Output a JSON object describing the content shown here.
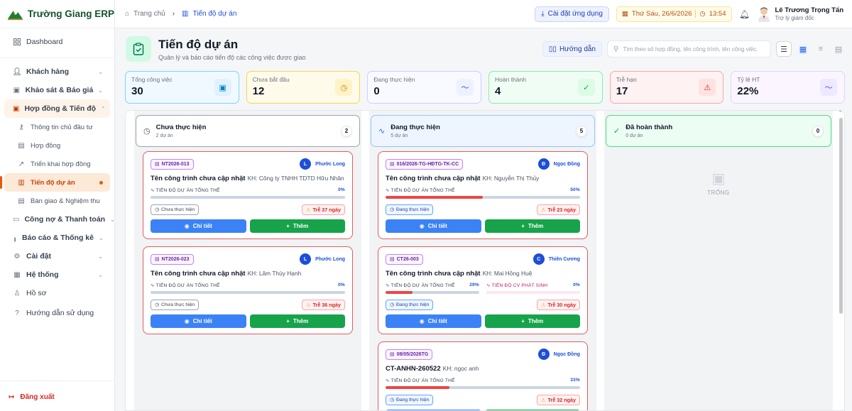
{
  "app": {
    "name": "Trường Giang ERP"
  },
  "sidebar": {
    "items": [
      {
        "label": "Dashboard"
      },
      {
        "label": "Khách hàng"
      },
      {
        "label": "Khảo sát & Báo giá"
      },
      {
        "label": "Hợp đồng & Tiến độ"
      },
      {
        "label": "Thông tin chủ đầu tư"
      },
      {
        "label": "Hợp đồng"
      },
      {
        "label": "Triển khai hợp đồng"
      },
      {
        "label": "Tiến độ dự án"
      },
      {
        "label": "Bàn giao & Nghiệm thu"
      },
      {
        "label": "Công nợ & Thanh toán"
      },
      {
        "label": "Báo cáo & Thống kê"
      },
      {
        "label": "Cài đặt"
      },
      {
        "label": "Hệ thống"
      },
      {
        "label": "Hồ sơ"
      },
      {
        "label": "Hướng dẫn sử dụng"
      }
    ],
    "logout": "Đăng xuất"
  },
  "topbar": {
    "breadcrumb_home": "Trang chủ",
    "breadcrumb_current": "Tiến độ dự án",
    "install_label": "Cài đặt ứng dụng",
    "date": "Thứ Sáu, 26/6/2026",
    "time": "13:54",
    "user_name": "Lê Trương Trọng Tấn",
    "user_role": "Trợ lý giám đốc"
  },
  "page": {
    "title": "Tiến độ dự án",
    "subtitle": "Quản lý và báo cáo tiến độ các công việc được giao",
    "guide_label": "Hướng dẫn",
    "search_placeholder": "Tìm theo số hợp đồng, tên công trình, tên công việc."
  },
  "stats": [
    {
      "label": "Tổng công việc",
      "value": "30",
      "color": "#38bdf8"
    },
    {
      "label": "Chưa bắt đầu",
      "value": "12",
      "color": "#f59e0b"
    },
    {
      "label": "Đang thực hiện",
      "value": "0",
      "color": "#818cf8"
    },
    {
      "label": "Hoàn thành",
      "value": "4",
      "color": "#22c55e"
    },
    {
      "label": "Trễ hạn",
      "value": "17",
      "color": "#f87171"
    },
    {
      "label": "Tỷ lệ HT",
      "value": "22%",
      "color": "#a78bfa"
    }
  ],
  "columns": [
    {
      "title": "Chưa thực hiện",
      "sub": "2 dự án",
      "count": "2"
    },
    {
      "title": "Đang thực hiện",
      "sub": "5 dự án",
      "count": "5"
    },
    {
      "title": "Đã hoàn thành",
      "sub": "0 dự án",
      "count": "0",
      "empty": "TRỐNG"
    }
  ],
  "cards": [
    {
      "code": "NT2026-013",
      "av": "L",
      "assignee": "Phước Long",
      "name": "Tên công trình chưa cập nhật",
      "kh": "KH: Công ty TNHH TDTD Hữu Nhân",
      "p1_label": "TIẾN ĐỘ DỰ ÁN TỔNG THỂ",
      "p1": "0%",
      "p1_val": 0,
      "status": "Chưa thực hiện",
      "late": "Trễ 37 ngày",
      "detail": "Chi tiết",
      "add": "Thêm"
    },
    {
      "code": "NT2026-023",
      "av": "L",
      "assignee": "Phước Long",
      "name": "Tên công trình chưa cập nhật",
      "kh": "KH: Lâm Thúy Hạnh",
      "p1_label": "TIẾN ĐỘ DỰ ÁN TỔNG THỂ",
      "p1": "0%",
      "p1_val": 0,
      "status": "Chưa thực hiện",
      "late": "Trễ 36 ngày",
      "detail": "Chi tiết",
      "add": "Thêm"
    },
    {
      "code": "016/2026-TG-HĐTG-TK-CC",
      "av": "Đ",
      "assignee": "Ngọc Đồng",
      "name": "Tên công trình chưa cập nhật",
      "kh": "KH: Nguyễn Thị Thủy",
      "p1_label": "TIẾN ĐỘ DỰ ÁN TỔNG THỂ",
      "p1": "50%",
      "p1_val": 50,
      "status": "Đang thực hiện",
      "late": "Trễ 23 ngày",
      "detail": "Chi tiết",
      "add": "Thêm"
    },
    {
      "code": "CT26-003",
      "av": "C",
      "assignee": "Thiên Cương",
      "name": "Tên công trình chưa cập nhật",
      "kh": "KH: Mai Hồng Huệ",
      "p1_label": "TIẾN ĐỘ DỰ ÁN TỔNG THỂ",
      "p1": "29%",
      "p1_val": 29,
      "p2_label": "TIẾN ĐỘ CV PHÁT SINH",
      "p2": "0%",
      "p2_val": 0,
      "status": "Đang thực hiện",
      "late": "Trễ 30 ngày",
      "detail": "Chi tiết",
      "add": "Thêm"
    },
    {
      "code": "08/05/2026TG",
      "av": "Đ",
      "assignee": "Ngọc Đồng",
      "name": "CT-ANHN-260522",
      "kh": "KH: ngọc anh",
      "p1_label": "TIẾN ĐỘ DỰ ÁN TỔNG THỂ",
      "p1": "33%",
      "p1_val": 33,
      "status": "Đang thực hiện",
      "late": "Trễ 32 ngày"
    }
  ]
}
